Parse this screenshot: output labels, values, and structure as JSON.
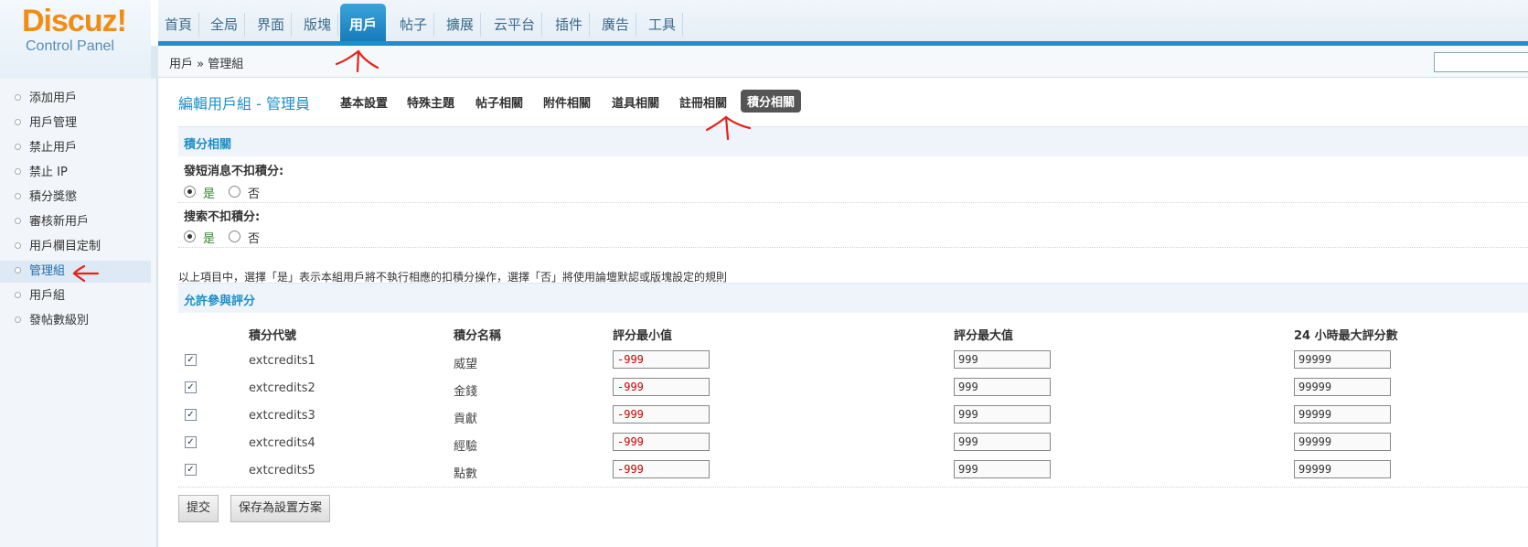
{
  "logo": {
    "title": "Discuz!",
    "subtitle": "Control Panel"
  },
  "topnav": [
    "首頁",
    "全局",
    "界面",
    "版塊",
    "用戶",
    "帖子",
    "擴展",
    "云平台",
    "插件",
    "廣告",
    "工具"
  ],
  "topnav_active": "用戶",
  "breadcrumb": "用戶 » 管理組",
  "sidebar": [
    "添加用戶",
    "用戶管理",
    "禁止用戶",
    "禁止 IP",
    "積分獎懲",
    "審核新用戶",
    "用戶欄目定制",
    "管理組",
    "用戶組",
    "發帖數級別"
  ],
  "sidebar_active": "管理組",
  "page_title": "編輯用戶組 - 管理員",
  "subtabs": [
    "基本設置",
    "特殊主題",
    "帖子相關",
    "附件相關",
    "道具相關",
    "註冊相關",
    "積分相關"
  ],
  "subtab_active": "積分相關",
  "section1": {
    "title": "積分相關",
    "q1": "發短消息不扣積分:",
    "q2": "搜索不扣積分:",
    "yes": "是",
    "no": "否",
    "q1_value": "是",
    "q2_value": "是",
    "note": "以上項目中，選擇「是」表示本組用戶將不執行相應的扣積分操作，選擇「否」將使用論壇默認或版塊設定的規則"
  },
  "section2": {
    "title": "允許參與評分",
    "headers": [
      "積分代號",
      "積分名稱",
      "評分最小值",
      "評分最大值",
      "24 小時最大評分數"
    ],
    "rows": [
      {
        "checked": true,
        "code": "extcredits1",
        "name": "威望",
        "min": "-999",
        "max": "999",
        "max24": "99999"
      },
      {
        "checked": true,
        "code": "extcredits2",
        "name": "金錢",
        "min": "-999",
        "max": "999",
        "max24": "99999"
      },
      {
        "checked": true,
        "code": "extcredits3",
        "name": "貢獻",
        "min": "-999",
        "max": "999",
        "max24": "99999"
      },
      {
        "checked": true,
        "code": "extcredits4",
        "name": "經驗",
        "min": "-999",
        "max": "999",
        "max24": "99999"
      },
      {
        "checked": true,
        "code": "extcredits5",
        "name": "點數",
        "min": "-999",
        "max": "999",
        "max24": "99999"
      }
    ]
  },
  "buttons": {
    "submit": "提交",
    "save_scheme": "保存為設置方案"
  },
  "colors": {
    "accent": "#1f8fc8",
    "logo_orange": "#f28c12",
    "annotation": "#e8211b"
  }
}
